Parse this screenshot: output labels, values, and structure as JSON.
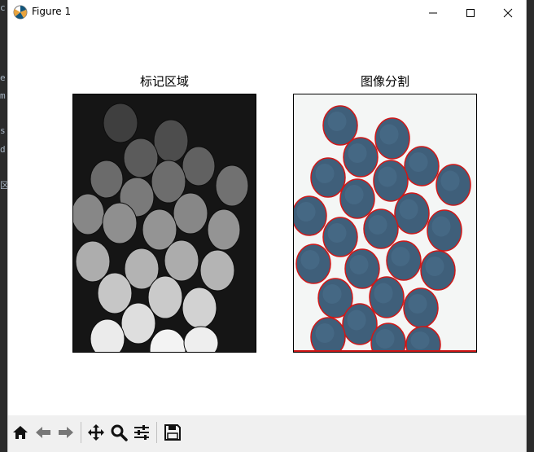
{
  "window": {
    "title": "Figure 1",
    "minimize_icon": "minimize-icon",
    "maximize_icon": "maximize-icon",
    "close_icon": "close-icon"
  },
  "ide_background": {
    "fragments": [
      "c",
      "e",
      "m",
      "s",
      "d",
      "区"
    ]
  },
  "figure": {
    "left_title": "标记区域",
    "right_title": "图像分割",
    "left_image": "grayscale labeled regions of coins on black background",
    "right_image": "coins with red segmentation contours on white background"
  },
  "toolbar": {
    "buttons": [
      {
        "name": "home",
        "icon": "home-icon"
      },
      {
        "name": "back",
        "icon": "back-arrow-icon"
      },
      {
        "name": "forward",
        "icon": "forward-arrow-icon"
      },
      {
        "name": "pan",
        "icon": "move-icon"
      },
      {
        "name": "zoom",
        "icon": "zoom-icon"
      },
      {
        "name": "configure",
        "icon": "sliders-icon"
      },
      {
        "name": "save",
        "icon": "save-icon"
      }
    ]
  },
  "colors": {
    "coin_blue": "#3f5f7a",
    "contour_red": "#d01818",
    "label_background": "#151515"
  }
}
